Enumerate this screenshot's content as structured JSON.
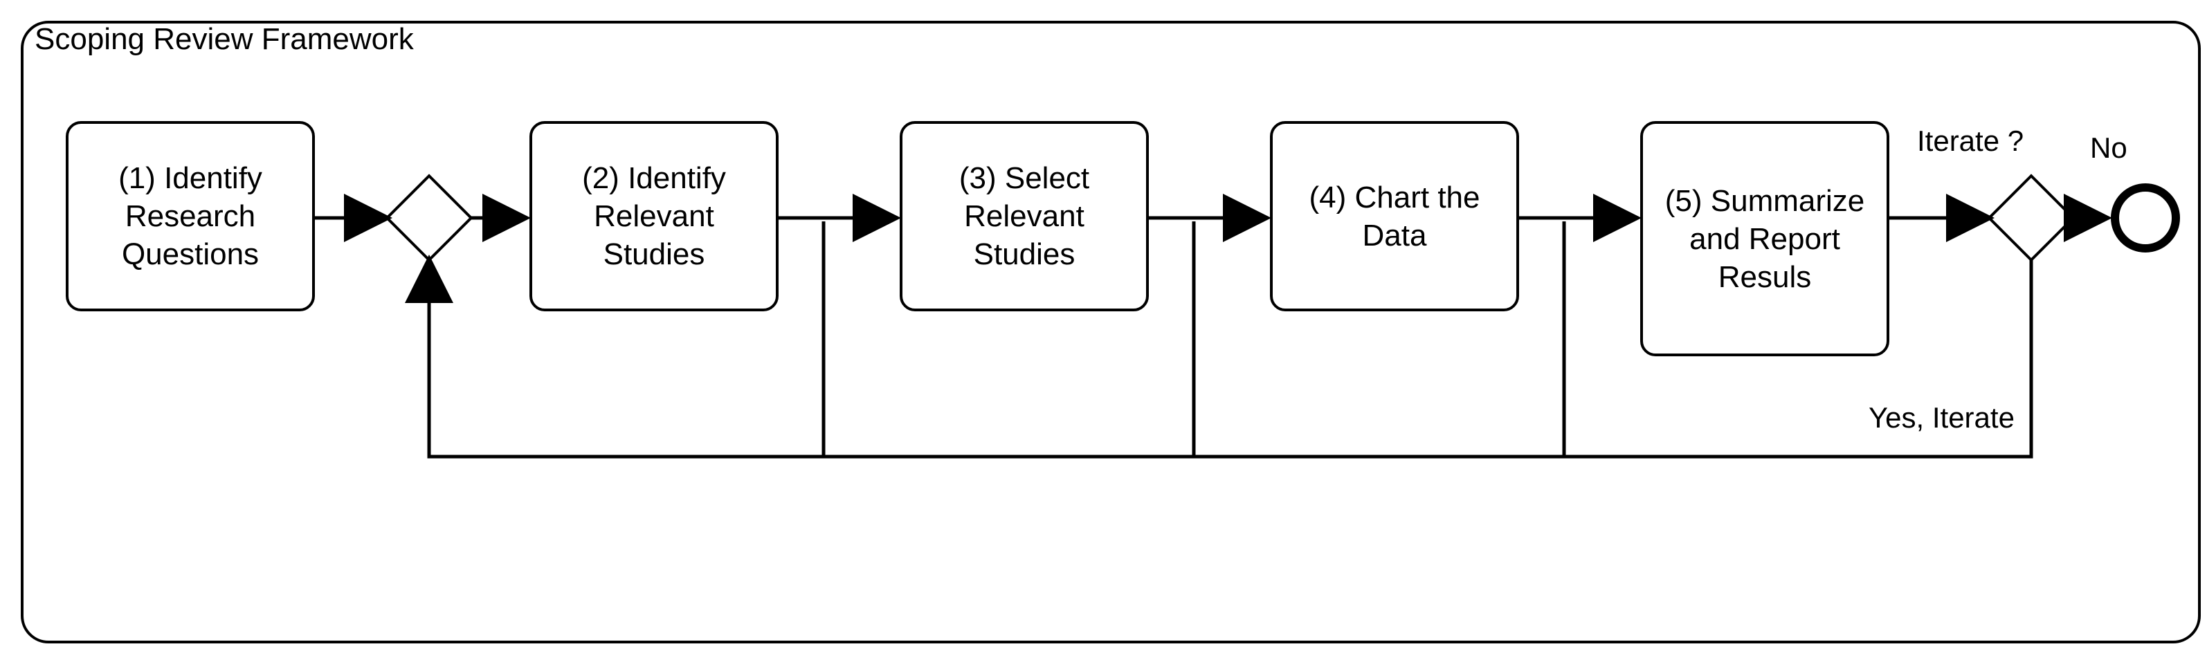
{
  "pool_title": "Scoping Review Framework",
  "tasks": {
    "t1": "(1) Identify Research Questions",
    "t2": "(2) Identify Relevant Studies",
    "t3": "(3) Select Relevant Studies",
    "t4": "(4) Chart the Data",
    "t5": "(5) Summarize and Report Resuls"
  },
  "labels": {
    "iterate_q": "Iterate ?",
    "no": "No",
    "yes": "Yes, Iterate"
  }
}
